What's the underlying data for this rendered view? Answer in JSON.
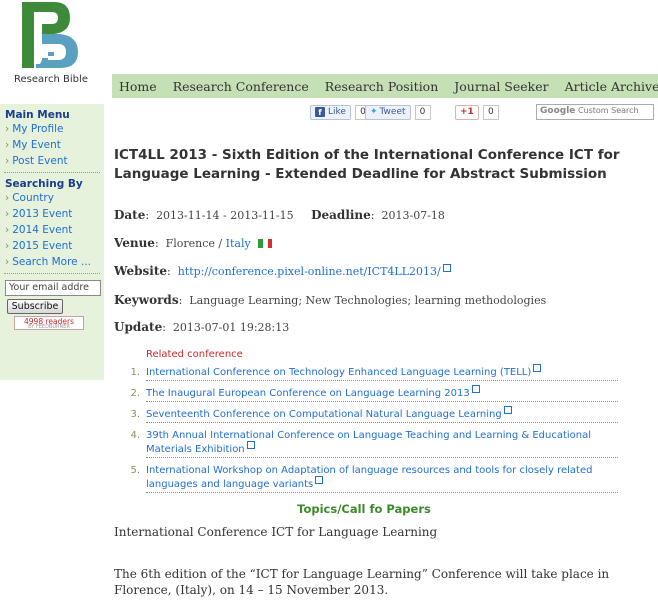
{
  "logo": {
    "text": "Research Bible"
  },
  "topnav": {
    "items": [
      "Home",
      "Research Conference",
      "Research Position",
      "Journal Seeker",
      "Article Archives"
    ]
  },
  "sidebar": {
    "main_menu_title": "Main Menu",
    "main_menu": [
      "My Profile",
      "My Event",
      "Post Event"
    ],
    "searching_title": "Searching By",
    "searching": [
      "Country",
      "2013 Event",
      "2014 Event",
      "2015 Event",
      "Search More ..."
    ],
    "email_placeholder": "Your email addre",
    "subscribe_label": "Subscribe",
    "readers_count": "4998",
    "readers_label": "readers",
    "feedburner": "BY FEEDBURNER"
  },
  "social": {
    "like_label": "Like",
    "like_count": "0",
    "tweet_label": "Tweet",
    "tweet_count": "0",
    "gplus_label": "+1",
    "gplus_count": "0",
    "search_placeholder": "Custom Search",
    "search_brand": "Google"
  },
  "event": {
    "title": "ICT4LL 2013 - Sixth Edition of the International Conference ICT for Language Learning - Extended Deadline for Abstract Submission",
    "date_label": "Date",
    "date_value": "2013-11-14 - 2013-11-15",
    "deadline_label": "Deadline",
    "deadline_value": "2013-07-18",
    "venue_label": "Venue",
    "venue_city": "Florence / ",
    "venue_country": "Italy",
    "website_label": "Website",
    "website_url": "http://conference.pixel-online.net/ICT4LL2013/",
    "keywords_label": "Keywords",
    "keywords_value": "Language Learning; New Technologies; learning methodologies",
    "update_label": "Update",
    "update_value": "2013-07-01 19:28:13"
  },
  "related": {
    "heading": "Related conference",
    "items": [
      "International Conference on Technology Enhanced Language Learning (TELL)",
      "The Inaugural European Conference on Language Learning 2013",
      "Seventeenth Conference on Computational Natural Language Learning",
      "39th Annual International Conference on Language Teaching and Learning & Educational Materials Exhibition",
      "International Workshop on Adaptation of language resources and tools for closely related languages and language variants"
    ]
  },
  "topics": {
    "heading": "Topics/Call fo Papers"
  },
  "body": {
    "p1": "International Conference ICT for Language Learning",
    "p2": "The 6th edition of the “ICT for Language Learning” Conference will take place in Florence, (Italy), on 14 – 15 November 2013."
  },
  "colors": {
    "nav_bg": "#c5e0b5",
    "sidebar_bg": "#e6f2dc",
    "link": "#1f6fd0",
    "accent_green": "#3a8a2a",
    "related_red": "#c62a2a"
  }
}
